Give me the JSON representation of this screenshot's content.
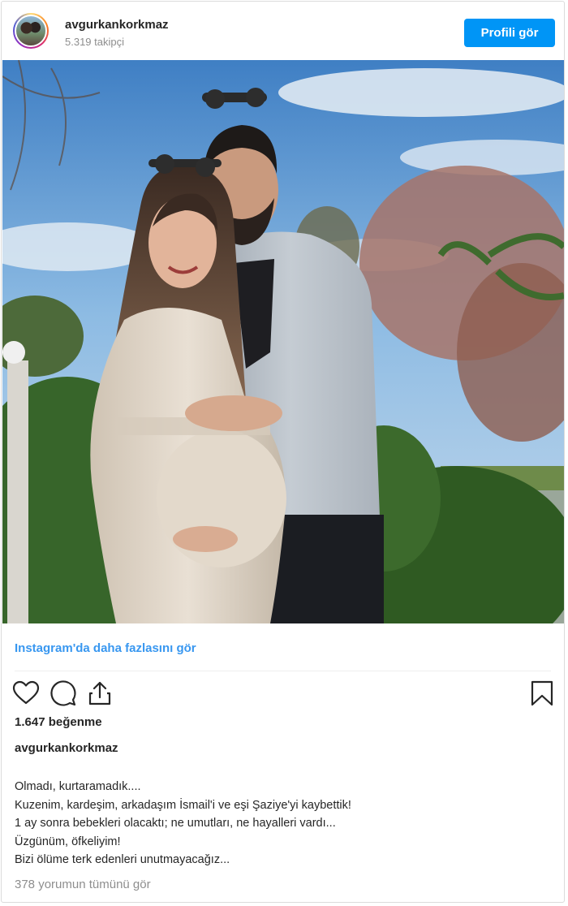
{
  "header": {
    "username": "avgurkankorkmaz",
    "followers": "5.319 takipçi",
    "profile_button": "Profili gör"
  },
  "more_link": "Instagram'da daha fazlasını gör",
  "actions": {
    "icons": [
      "heart-icon",
      "comment-icon",
      "share-icon",
      "bookmark-icon"
    ]
  },
  "likes": "1.647 beğenme",
  "caption": {
    "username": "avgurkankorkmaz",
    "lines": [
      "Olmadı, kurtaramadık....",
      "Kuzenim, kardeşim, arkadaşım İsmail'i ve eşi Şaziye'yi kaybettik!",
      "1 ay sonra bebekleri olacaktı; ne umutları, ne hayalleri vardı...",
      "Üzgünüm, öfkeliyim!",
      "Bizi ölüme terk edenleri unutmayacağız..."
    ]
  },
  "comments_link": "378 yorumun tümünü gör",
  "colors": {
    "accent": "#0095f6",
    "link": "#3897f0",
    "muted": "#8e8e8e",
    "text": "#262626"
  }
}
